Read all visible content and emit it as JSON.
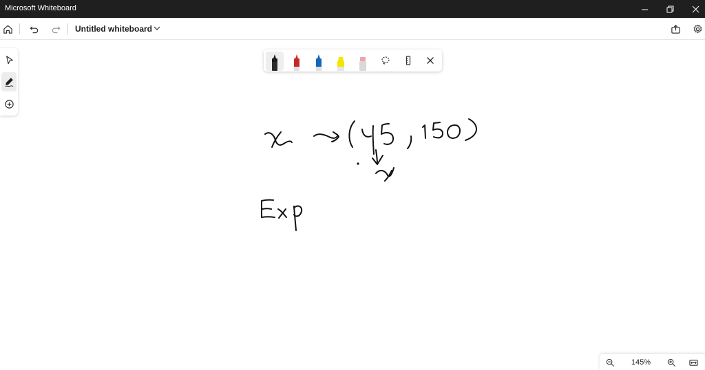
{
  "window": {
    "title": "Microsoft Whiteboard",
    "controls": [
      "minimize-icon",
      "restore-icon",
      "close-icon"
    ]
  },
  "toolbar": {
    "document_title": "Untitled whiteboard",
    "left_icons": [
      "home-icon",
      "undo-icon",
      "redo-icon"
    ],
    "right_icons": [
      "share-icon",
      "settings-icon"
    ]
  },
  "side_tools": [
    {
      "name": "select-icon",
      "active": false
    },
    {
      "name": "inking-icon",
      "active": true
    },
    {
      "name": "add-icon",
      "active": false
    }
  ],
  "ink_toolbar": {
    "pens": [
      {
        "name": "black-pen",
        "color": "#1a1a1a",
        "selected": true
      },
      {
        "name": "red-pen",
        "color": "#d32f2f",
        "selected": false
      },
      {
        "name": "blue-pen",
        "color": "#1565c0",
        "selected": false
      },
      {
        "name": "yellow-highlighter",
        "color": "#f5e400",
        "selected": false
      },
      {
        "name": "pink-highlighter",
        "color": "#f0a3a8",
        "selected": false
      }
    ],
    "tools": [
      "lasso-icon",
      "ruler-icon",
      "close-icon"
    ]
  },
  "zoom": {
    "level": "145%"
  },
  "colors": {
    "titlebar": "#1f1f1f",
    "ink": "#111111"
  }
}
